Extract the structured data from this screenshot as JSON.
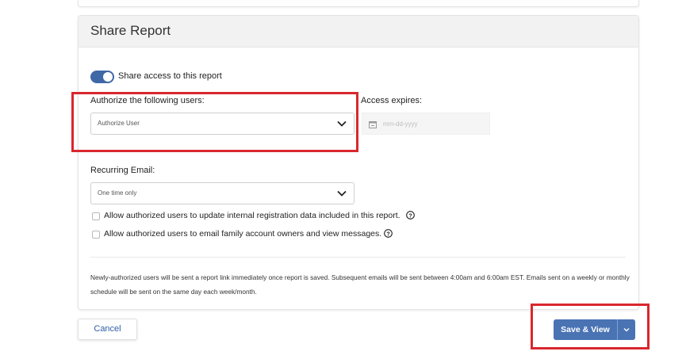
{
  "share_report": {
    "title": "Share Report",
    "toggle_label": "Share access to this report",
    "toggle_on": true,
    "authorize_label": "Authorize the following users:",
    "authorize_value": "Authorize User",
    "access_expires_label": "Access expires:",
    "access_expires_placeholder": "mm-dd-yyyy",
    "recurring_label": "Recurring Email:",
    "recurring_value": "One time only",
    "checkbox_update": "Allow authorized users to update internal registration data included in this report.",
    "checkbox_email": "Allow authorized users to email family account owners and view messages.",
    "footnote": "Newly-authorized users will be sent a report link immediately once report is saved. Subsequent emails will be sent between 4:00am and 6:00am EST. Emails sent on a weekly or monthly schedule will be sent on the same day each week/month."
  },
  "actions": {
    "cancel_label": "Cancel",
    "save_view_label": "Save & View"
  },
  "colors": {
    "accent": "#4a73b4",
    "toggle": "#3f68a6",
    "highlight": "#d9272e"
  },
  "icons": {
    "select": "chevron-down-icon",
    "date": "calendar-icon",
    "help": "help-circle-icon",
    "caret": "caret-down-icon"
  }
}
